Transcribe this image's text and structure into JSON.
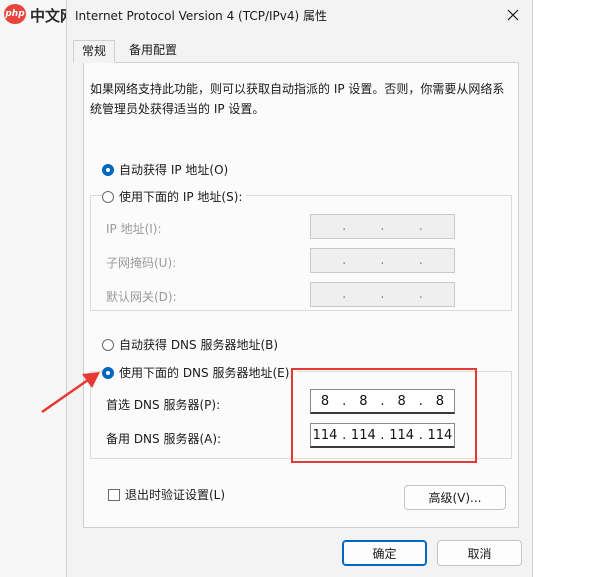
{
  "watermark": {
    "badge": "php",
    "text": "中文网"
  },
  "window": {
    "title": "Internet Protocol Version 4 (TCP/IPv4) 属性"
  },
  "tabs": [
    {
      "label": "常规",
      "active": true
    },
    {
      "label": "备用配置",
      "active": false
    }
  ],
  "general": {
    "description": "如果网络支持此功能，则可以获取自动指派的 IP 设置。否则，你需要从网络系统管理员处获得适当的 IP 设置。",
    "ip_auto_label": "自动获得 IP 地址(O)",
    "ip_manual_label": "使用下面的 IP 地址(S):",
    "ip_address_label": "IP 地址(I):",
    "subnet_label": "子网掩码(U):",
    "gateway_label": "默认网关(D):",
    "dns_auto_label": "自动获得 DNS 服务器地址(B)",
    "dns_manual_label": "使用下面的 DNS 服务器地址(E):",
    "preferred_dns_label": "首选 DNS 服务器(P):",
    "alternate_dns_label": "备用 DNS 服务器(A):",
    "preferred_dns": [
      "8",
      "8",
      "8",
      "8"
    ],
    "alternate_dns": [
      "114",
      "114",
      "114",
      "114"
    ],
    "validate_label": "退出时验证设置(L)",
    "advanced_label": "高级(V)..."
  },
  "footer": {
    "ok_label": "确定",
    "cancel_label": "取消"
  },
  "colors": {
    "accent": "#0067c0",
    "highlight": "#e53935"
  },
  "icons": {
    "close": "close-icon",
    "annotation": "arrow-icon"
  }
}
